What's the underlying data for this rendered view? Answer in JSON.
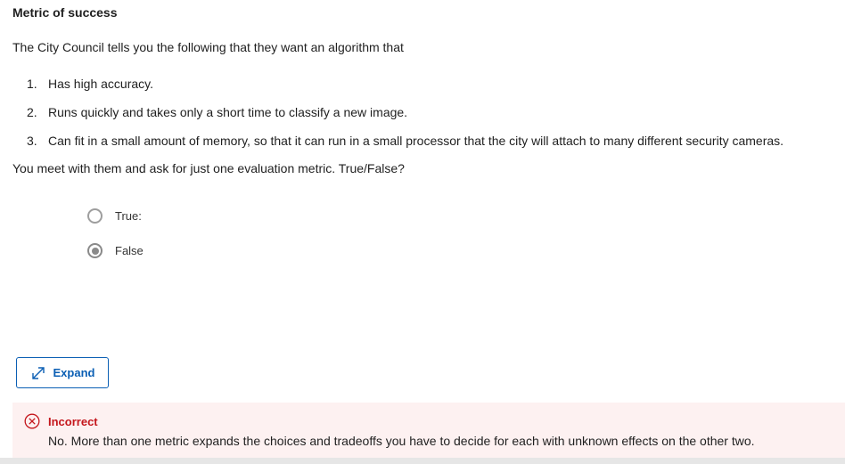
{
  "question": {
    "title": "Metric of success",
    "intro": "The City Council tells you the following that they want an algorithm that",
    "requirements": [
      {
        "number": "1.",
        "text": "Has high accuracy."
      },
      {
        "number": "2.",
        "text": "Runs quickly and takes only a short time to classify a new image."
      },
      {
        "number": "3.",
        "text": "Can fit in a small amount of memory, so that it can run in a small processor that the city will attach to many different security cameras."
      }
    ],
    "prompt": "You meet with them and ask for just one evaluation metric. True/False?",
    "options": [
      {
        "label": "True:",
        "selected": false
      },
      {
        "label": "False",
        "selected": true
      }
    ]
  },
  "expand_button": {
    "label": "Expand",
    "icon": "expand-arrows-icon",
    "color": "#0b5fb4"
  },
  "feedback": {
    "status": "Incorrect",
    "icon": "x-circle-icon",
    "message": "No. More than one metric expands the choices and tradeoffs you have to decide for each with unknown effects on the other two.",
    "status_color": "#c4161c",
    "background": "#fdf1f1"
  }
}
